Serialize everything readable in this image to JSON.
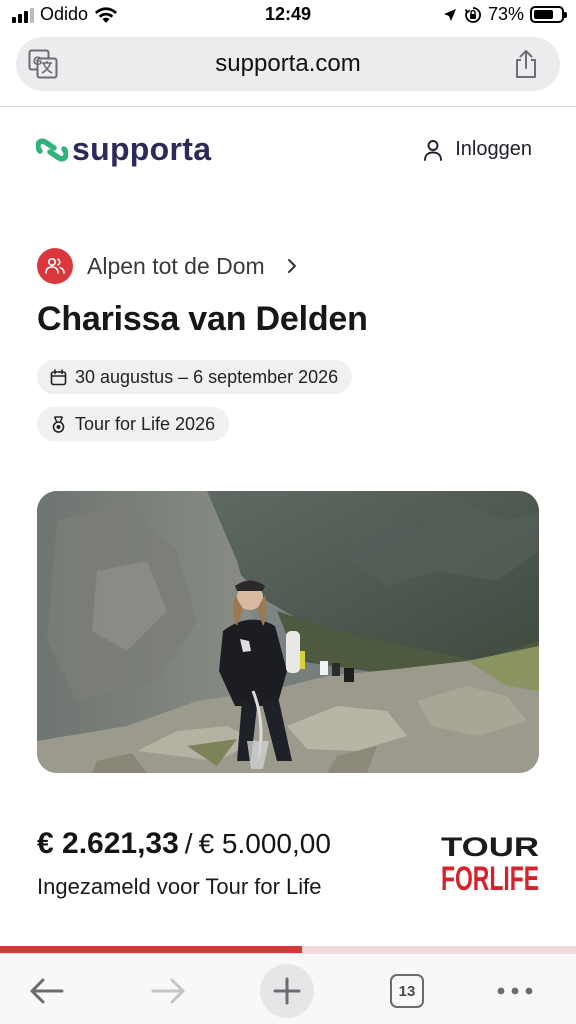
{
  "status_bar": {
    "carrier": "Odido",
    "time": "12:49",
    "battery_percent": "73%",
    "battery_level": 0.73,
    "icons": [
      "signal-icon",
      "wifi-icon",
      "location-icon",
      "orientation-lock-icon",
      "battery-icon"
    ]
  },
  "browser": {
    "url": "supporta.com",
    "icons": [
      "translate-icon",
      "share-icon"
    ]
  },
  "site_header": {
    "logo_text": "supporta",
    "login_label": "Inloggen",
    "icons": [
      "supporta-logo-icon",
      "user-icon"
    ]
  },
  "campaign": {
    "team_name": "Alpen tot de Dom",
    "participant_name": "Charissa van Delden",
    "dates": "30 augustus – 6 september 2026",
    "event": "Tour for Life 2026",
    "icons": [
      "team-icon",
      "chevron-right-icon",
      "calendar-icon",
      "medal-icon"
    ]
  },
  "fundraising": {
    "raised": "€ 2.621,33",
    "separator": "/",
    "goal": "€ 5.000,00",
    "label": "Ingezameld voor Tour for Life",
    "progress_fraction": 0.524,
    "partner_logo_line1": "TOUR",
    "partner_logo_line2a": "FOR",
    "partner_logo_line2b": "LIFE"
  },
  "toolbar": {
    "tab_count": "13",
    "icons": [
      "back-arrow-icon",
      "forward-arrow-icon",
      "plus-icon",
      "tabs-icon",
      "more-icon"
    ]
  },
  "colors": {
    "brand_green": "#2fb37a",
    "brand_navy": "#2b2a5a",
    "accent_red": "#d9373c",
    "progress_red": "#d33a3a",
    "tfl_black": "#1b1b1b",
    "tfl_red": "#d4232b"
  }
}
